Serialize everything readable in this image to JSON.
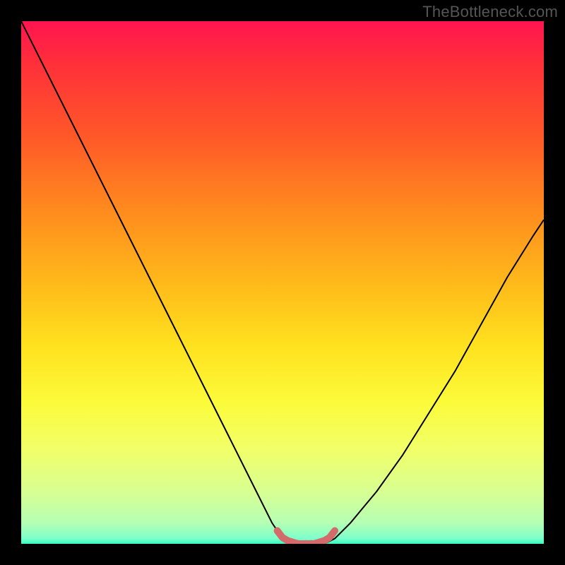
{
  "watermark": "TheBottleneck.com",
  "chart_data": {
    "type": "line",
    "title": "",
    "xlabel": "",
    "ylabel": "",
    "xlim": [
      0,
      100
    ],
    "ylim": [
      0,
      100
    ],
    "grid": false,
    "legend": false,
    "gradient_stops": [
      {
        "pos": 0,
        "color": "#ff1450"
      },
      {
        "pos": 8,
        "color": "#ff2f3a"
      },
      {
        "pos": 22,
        "color": "#ff5828"
      },
      {
        "pos": 36,
        "color": "#ff8a1e"
      },
      {
        "pos": 50,
        "color": "#ffb91a"
      },
      {
        "pos": 62,
        "color": "#ffe11e"
      },
      {
        "pos": 73,
        "color": "#fcfb3a"
      },
      {
        "pos": 82,
        "color": "#f1ff69"
      },
      {
        "pos": 90,
        "color": "#d8ff92"
      },
      {
        "pos": 96,
        "color": "#b5ffb4"
      },
      {
        "pos": 99,
        "color": "#7cffca"
      },
      {
        "pos": 100,
        "color": "#35ffc3"
      }
    ],
    "series": [
      {
        "name": "bottleneck-curve",
        "color": "#000000",
        "stroke_width": 2,
        "x": [
          0,
          5,
          10,
          15,
          20,
          25,
          30,
          35,
          40,
          45,
          48,
          50,
          53,
          56,
          58,
          60,
          63,
          68,
          73,
          78,
          83,
          88,
          93,
          98,
          100
        ],
        "y": [
          100,
          90,
          80,
          70,
          60,
          50,
          40,
          30,
          20,
          10,
          4,
          1,
          0,
          0,
          0,
          1,
          4,
          10,
          17,
          25,
          33,
          42,
          51,
          59,
          62
        ]
      },
      {
        "name": "optimal-segment",
        "color": "#d46a6a",
        "stroke_width": 10,
        "stroke_linecap": "round",
        "x": [
          49,
          50,
          51,
          52,
          53,
          54,
          55,
          56,
          57,
          58,
          59,
          60
        ],
        "y": [
          2.5,
          1.2,
          0.6,
          0.3,
          0,
          0,
          0,
          0,
          0.3,
          0.6,
          1.2,
          2.5
        ]
      }
    ],
    "annotations": []
  }
}
